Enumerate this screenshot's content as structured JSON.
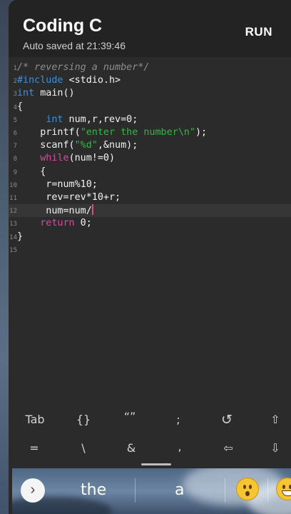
{
  "header": {
    "title": "Coding C",
    "subtitle": "Auto saved at 21:39:46",
    "run_label": "RUN"
  },
  "editor": {
    "lines": [
      {
        "n": "1",
        "segments": [
          {
            "t": "/* reversing a number*/",
            "c": "cmt"
          }
        ]
      },
      {
        "n": "2",
        "segments": [
          {
            "t": "#include",
            "c": "kw"
          },
          {
            "t": " <stdio.h>",
            "c": ""
          }
        ]
      },
      {
        "n": "3",
        "segments": [
          {
            "t": "int",
            "c": "kw"
          },
          {
            "t": " main()",
            "c": ""
          }
        ]
      },
      {
        "n": "4",
        "segments": [
          {
            "t": "{",
            "c": ""
          }
        ]
      },
      {
        "n": "5",
        "segments": [
          {
            "t": "     ",
            "c": ""
          },
          {
            "t": "int",
            "c": "kw"
          },
          {
            "t": " num,r,rev=0;",
            "c": ""
          }
        ]
      },
      {
        "n": "6",
        "segments": [
          {
            "t": "    printf(",
            "c": ""
          },
          {
            "t": "\"enter the number\\n\"",
            "c": "str"
          },
          {
            "t": ");",
            "c": ""
          }
        ]
      },
      {
        "n": "7",
        "segments": [
          {
            "t": "    scanf(",
            "c": ""
          },
          {
            "t": "\"%d\"",
            "c": "str"
          },
          {
            "t": ",&num);",
            "c": ""
          }
        ]
      },
      {
        "n": "8",
        "segments": [
          {
            "t": "    ",
            "c": ""
          },
          {
            "t": "while",
            "c": "ctl"
          },
          {
            "t": "(num!=0)",
            "c": ""
          }
        ]
      },
      {
        "n": "9",
        "segments": [
          {
            "t": "    {",
            "c": ""
          }
        ]
      },
      {
        "n": "10",
        "segments": [
          {
            "t": "     r=num%10;",
            "c": ""
          }
        ]
      },
      {
        "n": "11",
        "segments": [
          {
            "t": "     rev=rev*10+r;",
            "c": ""
          }
        ]
      },
      {
        "n": "12",
        "segments": [
          {
            "t": "     num=num/",
            "c": ""
          }
        ],
        "active": true
      },
      {
        "n": "13",
        "segments": [
          {
            "t": "    ",
            "c": ""
          },
          {
            "t": "return",
            "c": "ctl"
          },
          {
            "t": " 0;",
            "c": ""
          }
        ]
      },
      {
        "n": "14",
        "segments": [
          {
            "t": "}",
            "c": ""
          }
        ]
      },
      {
        "n": "15",
        "segments": []
      }
    ]
  },
  "shortcuts": {
    "row1": [
      "Tab",
      "{}",
      "“”",
      ";",
      "↺",
      "⇧"
    ],
    "row2": [
      "=",
      "\\",
      "&",
      ",",
      "⇦",
      "⇩"
    ]
  },
  "keyboard": {
    "expand_icon": "chevron-right-icon",
    "suggestions": [
      "the",
      "a"
    ],
    "emoji_icons": [
      "surprised-face-icon",
      "smiling-face-icon"
    ]
  },
  "colors": {
    "keyword": "#3f8fd8",
    "control": "#d54da0",
    "string": "#2fba3e",
    "comment": "#8e8e8e",
    "cursor": "#e84a7f"
  }
}
